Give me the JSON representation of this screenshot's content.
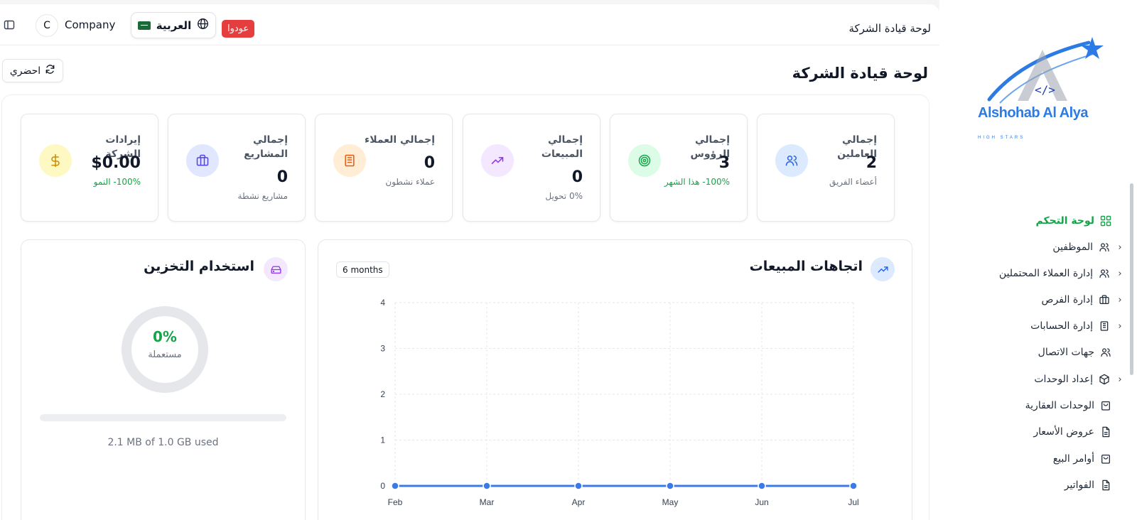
{
  "topbar": {
    "company_initial": "C",
    "company_name": "Company",
    "language_label": "العربية",
    "back_badge": "عودوا",
    "title": "لوحة قيادة الشركة"
  },
  "header": {
    "refresh_label": "احضري",
    "page_title": "لوحة قيادة الشركة"
  },
  "stats": [
    {
      "title": "إجمالي العاملين",
      "value": "2",
      "sub": "أعضاء الفريق",
      "sub_color": "gray",
      "icon": "users-icon",
      "color": "#2563eb"
    },
    {
      "title": "إجمالي الرؤوس",
      "value": "3",
      "sub": "100%- هذا الشهر",
      "sub_color": "green",
      "icon": "target-icon",
      "color": "#16a34a"
    },
    {
      "title": "إجمالي المبيعات",
      "value": "0",
      "sub": "0% تحويل",
      "sub_color": "gray",
      "icon": "trending-up-icon",
      "color": "#9333ea"
    },
    {
      "title": "إجمالي العملاء",
      "value": "0",
      "sub": "عملاء نشطون",
      "sub_color": "gray",
      "icon": "building-icon",
      "color": "#ea580c"
    },
    {
      "title": "إجمالي المشاريع",
      "value": "0",
      "sub": "مشاريع نشطة",
      "sub_color": "gray",
      "icon": "briefcase-icon",
      "color": "#4f46e5"
    },
    {
      "title": "إيرادات الشركة",
      "value": "$0.00",
      "sub": "100%- النمو",
      "sub_color": "green",
      "icon": "dollar-icon",
      "color": "#ca8a04"
    }
  ],
  "sales": {
    "title": "اتجاهات المبيعات",
    "range_badge": "6 months"
  },
  "chart_data": {
    "type": "line",
    "categories": [
      "Feb",
      "Mar",
      "Apr",
      "May",
      "Jun",
      "Jul"
    ],
    "series": [
      {
        "values": [
          0,
          0,
          0,
          0,
          0,
          0
        ]
      }
    ],
    "yticks": [
      "0",
      "1",
      "2",
      "3",
      "4"
    ],
    "ylim": [
      0,
      4
    ],
    "grid": true,
    "color": "#3b7be8"
  },
  "storage": {
    "title": "استخدام التخزين",
    "percent_label": "0%",
    "percent_value": 0,
    "used_label": "مستعملة",
    "usage_text": "2.1 MB of 1.0 GB used"
  },
  "sidebar": {
    "logo_text": "Alshohab Al Alya",
    "logo_sub": "HIGH STARS",
    "items": [
      {
        "label": "لوحة التحكم",
        "icon": "dashboard-icon",
        "chevron": false,
        "active": true
      },
      {
        "label": "الموظفين",
        "icon": "users-icon",
        "chevron": true,
        "active": false
      },
      {
        "label": "إدارة العملاء المحتملين",
        "icon": "users-icon",
        "chevron": true,
        "active": false
      },
      {
        "label": "إدارة الفرص",
        "icon": "briefcase-icon",
        "chevron": true,
        "active": false
      },
      {
        "label": "إدارة الحسابات",
        "icon": "building-icon",
        "chevron": true,
        "active": false
      },
      {
        "label": "جهات الاتصال",
        "icon": "users-icon",
        "chevron": false,
        "active": false
      },
      {
        "label": "إعداد الوحدات",
        "icon": "box-icon",
        "chevron": true,
        "active": false
      },
      {
        "label": "الوحدات العقارية",
        "icon": "bag-icon",
        "chevron": false,
        "active": false
      },
      {
        "label": "عروض الأسعار",
        "icon": "file-icon",
        "chevron": false,
        "active": false
      },
      {
        "label": "أوامر البيع",
        "icon": "bag-icon",
        "chevron": false,
        "active": false
      },
      {
        "label": "الفواتير",
        "icon": "file-icon",
        "chevron": false,
        "active": false
      }
    ]
  }
}
